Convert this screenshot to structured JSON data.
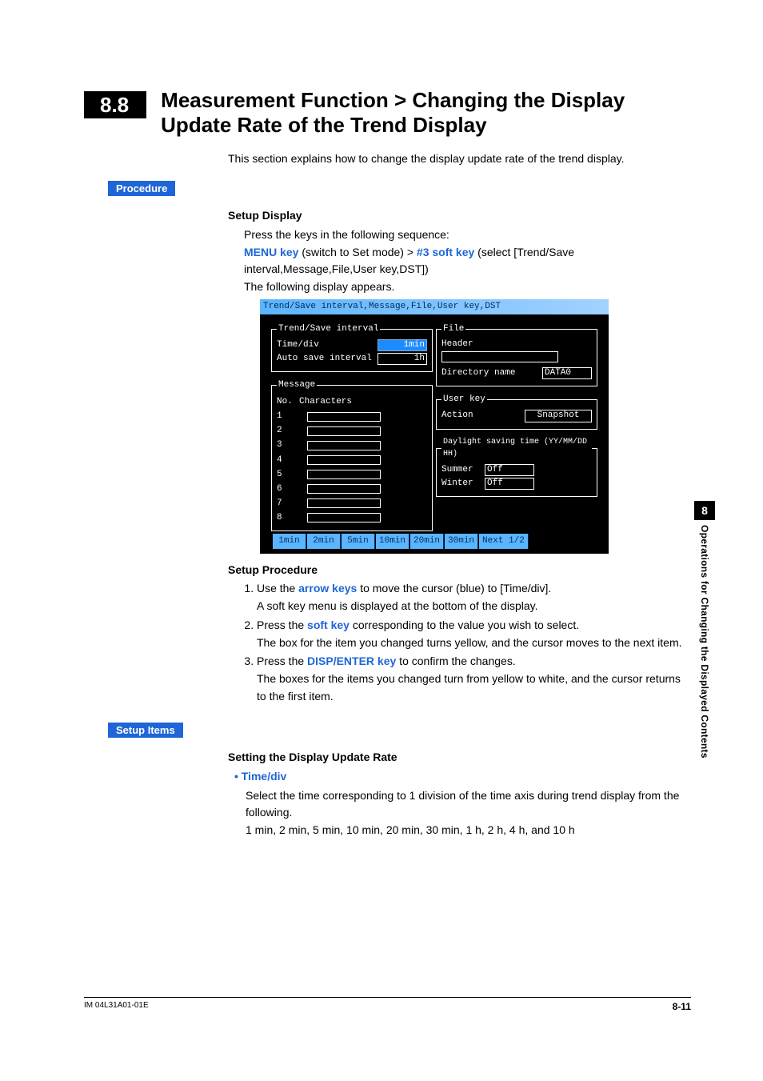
{
  "section": {
    "number": "8.8",
    "title": "Measurement Function > Changing the Display Update Rate of the Trend Display",
    "intro": "This section explains how to change the display update rate of the trend display."
  },
  "badges": {
    "procedure": "Procedure",
    "setup_items": "Setup Items"
  },
  "setup_display": {
    "heading": "Setup Display",
    "line1": "Press the keys in the following sequence:",
    "menu_key": "MENU key",
    "menu_key_post": " (switch to Set mode) > ",
    "softkey": "#3 soft key",
    "softkey_post": " (select [Trend/Save interval,Message,File,User key,DST])",
    "line3": "The following display appears."
  },
  "screenshot": {
    "title": "Trend/Save interval,Message,File,User key,DST",
    "trendsave": {
      "legend": "Trend/Save interval",
      "timediv_label": "Time/div",
      "timediv_value": "1min",
      "autosave_label": "Auto save interval",
      "autosave_value": "1h"
    },
    "message": {
      "legend": "Message",
      "col_no": "No.",
      "col_chars": "Characters",
      "rows": [
        "1",
        "2",
        "3",
        "4",
        "5",
        "6",
        "7",
        "8"
      ]
    },
    "file": {
      "legend": "File",
      "header_label": "Header",
      "dir_label": "Directory name",
      "dir_value": "DATA0"
    },
    "userkey": {
      "legend": "User key",
      "action_label": "Action",
      "action_value": "Snapshot"
    },
    "dst": {
      "legend": "Daylight saving time (YY/MM/DD HH)",
      "summer_label": "Summer",
      "summer_value": "Off",
      "winter_label": "Winter",
      "winter_value": "Off"
    },
    "softkeys": [
      "1min",
      "2min",
      "5min",
      "10min",
      "20min",
      "30min",
      "Next 1/2"
    ]
  },
  "setup_procedure": {
    "heading": "Setup Procedure",
    "steps": [
      {
        "pre": "Use the ",
        "key": "arrow keys",
        "post": " to move the cursor (blue) to [Time/div].",
        "line2": "A soft key menu is displayed at the bottom of the display."
      },
      {
        "pre": "Press the ",
        "key": "soft key",
        "post": " corresponding to the value you wish to select.",
        "line2": "The box for the item you changed turns yellow, and the cursor moves to the next item."
      },
      {
        "pre": "Press the ",
        "key": "DISP/ENTER key",
        "post": " to confirm the changes.",
        "line2": "The boxes for the items you changed turn from yellow to white, and the cursor returns to the first item."
      }
    ]
  },
  "setup_items": {
    "heading": "Setting the Display Update Rate",
    "item_label": "Time/div",
    "desc": "Select the time corresponding to 1 division of the time axis during trend display from the following.",
    "values": "1 min, 2 min, 5 min, 10 min, 20 min, 30 min, 1 h, 2 h, 4 h, and 10 h"
  },
  "side_tab": {
    "chapter": "8",
    "text": "Operations for Changing the Displayed Contents"
  },
  "footer": {
    "doc_id": "IM 04L31A01-01E",
    "page": "8-11"
  }
}
